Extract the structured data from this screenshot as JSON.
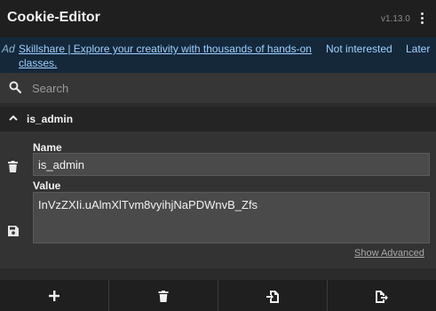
{
  "header": {
    "title": "Cookie-Editor",
    "version": "v1.13.0",
    "menu_icon": "kebab-menu-icon"
  },
  "ad": {
    "tag": "Ad",
    "link_text": "Skillshare | Explore your creativity with thousands of hands-on classes.",
    "not_interested": "Not interested",
    "later": "Later"
  },
  "search": {
    "placeholder": "Search",
    "value": "",
    "icon": "search-icon"
  },
  "cookie": {
    "name": "is_admin",
    "expanded": true,
    "name_label": "Name",
    "name_value": "is_admin",
    "value_label": "Value",
    "value_value": "InVzZXIi.uAlmXlTvm8vyihjNaPDWnvB_Zfs",
    "show_advanced": "Show Advanced"
  },
  "footer": {
    "buttons": [
      "add-icon",
      "delete-all-icon",
      "import-icon",
      "export-icon"
    ]
  },
  "colors": {
    "header_bg": "#1f1f1f",
    "ad_bg": "#14283a",
    "ad_link": "#9fd0ff",
    "panel_bg": "#333333",
    "field_bg": "#4a4a4a"
  }
}
